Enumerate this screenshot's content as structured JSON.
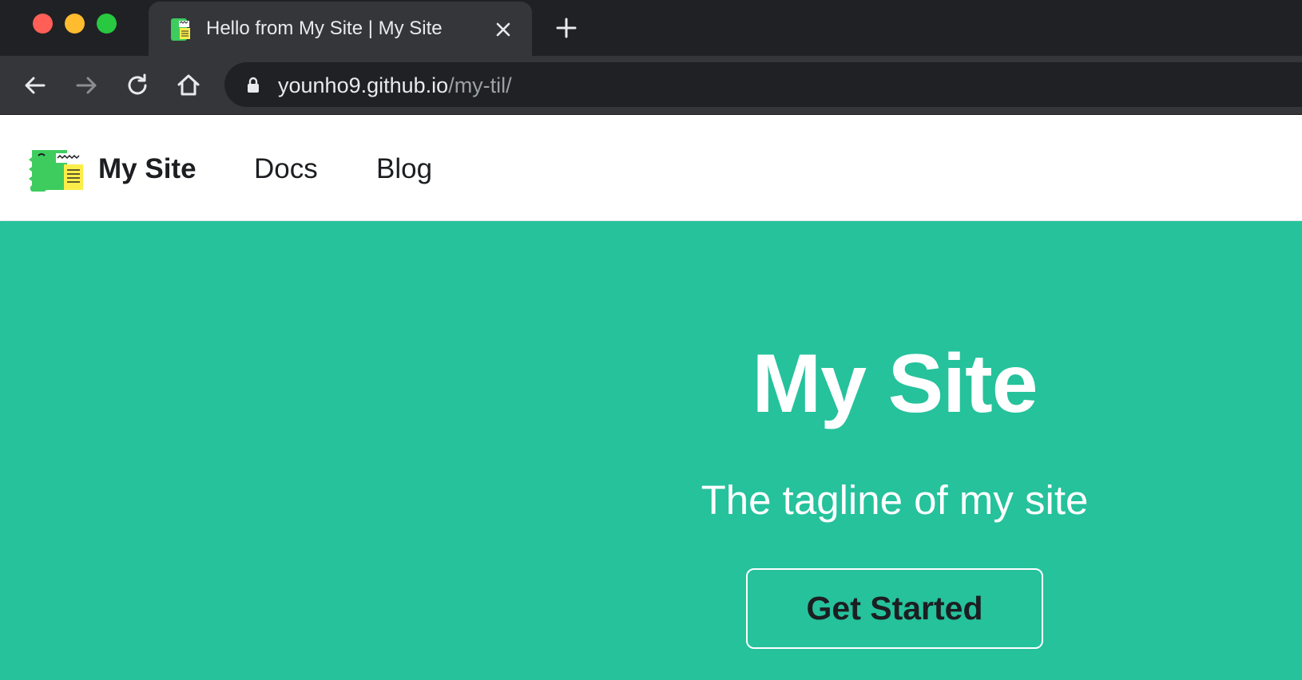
{
  "browser": {
    "tab": {
      "title": "Hello from My Site | My Site",
      "favicon": "docusaurus-dino-icon"
    },
    "new_tab_icon": "plus-icon",
    "address_bar": {
      "host": "younho9.github.io",
      "path": "/my-til/",
      "lock_icon": "lock-icon"
    },
    "nav_icons": [
      "back-arrow-icon",
      "forward-arrow-icon",
      "reload-icon",
      "home-icon"
    ],
    "colors": {
      "tabbar": "#202124",
      "toolbar": "#35363a",
      "omnibox": "#202124"
    }
  },
  "site": {
    "navbar": {
      "brand": "My Site",
      "links": [
        "Docs",
        "Blog"
      ]
    },
    "hero": {
      "title": "My Site",
      "tagline": "The tagline of my site",
      "cta_label": "Get Started"
    },
    "colors": {
      "primary": "#25c29c",
      "text_dark": "#1c1e21"
    }
  }
}
